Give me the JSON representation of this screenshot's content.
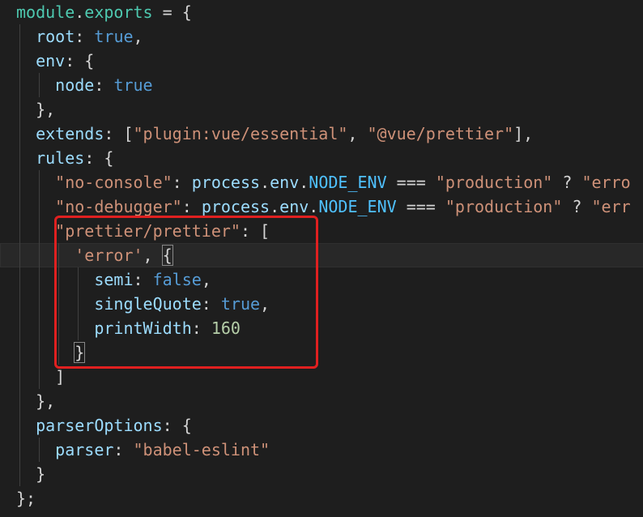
{
  "editor": {
    "theme_background": "#1e1e1e",
    "annotation_color": "#e02020",
    "lines": [
      {
        "tokens": [
          {
            "t": "module",
            "c": "tok-prop"
          },
          {
            "t": ".",
            "c": "tok-punc"
          },
          {
            "t": "exports",
            "c": "tok-prop"
          },
          {
            "t": " = {",
            "c": "tok-punc"
          }
        ]
      },
      {
        "tokens": [
          {
            "t": "  ",
            "c": "tok-punc"
          },
          {
            "t": "root",
            "c": "tok-key"
          },
          {
            "t": ": ",
            "c": "tok-punc"
          },
          {
            "t": "true",
            "c": "tok-kw"
          },
          {
            "t": ",",
            "c": "tok-punc"
          }
        ]
      },
      {
        "tokens": [
          {
            "t": "  ",
            "c": "tok-punc"
          },
          {
            "t": "env",
            "c": "tok-key"
          },
          {
            "t": ": {",
            "c": "tok-punc"
          }
        ]
      },
      {
        "tokens": [
          {
            "t": "    ",
            "c": "tok-punc"
          },
          {
            "t": "node",
            "c": "tok-key"
          },
          {
            "t": ": ",
            "c": "tok-punc"
          },
          {
            "t": "true",
            "c": "tok-kw"
          }
        ]
      },
      {
        "tokens": [
          {
            "t": "  },",
            "c": "tok-punc"
          }
        ]
      },
      {
        "tokens": [
          {
            "t": "  ",
            "c": "tok-punc"
          },
          {
            "t": "extends",
            "c": "tok-key"
          },
          {
            "t": ": [",
            "c": "tok-punc"
          },
          {
            "t": "\"plugin:vue/essential\"",
            "c": "tok-str"
          },
          {
            "t": ", ",
            "c": "tok-punc"
          },
          {
            "t": "\"@vue/prettier\"",
            "c": "tok-str"
          },
          {
            "t": "],",
            "c": "tok-punc"
          }
        ]
      },
      {
        "tokens": [
          {
            "t": "  ",
            "c": "tok-punc"
          },
          {
            "t": "rules",
            "c": "tok-key"
          },
          {
            "t": ": {",
            "c": "tok-punc"
          }
        ]
      },
      {
        "tokens": [
          {
            "t": "    ",
            "c": "tok-punc"
          },
          {
            "t": "\"no-console\"",
            "c": "tok-str"
          },
          {
            "t": ": ",
            "c": "tok-punc"
          },
          {
            "t": "process",
            "c": "tok-ident"
          },
          {
            "t": ".",
            "c": "tok-punc"
          },
          {
            "t": "env",
            "c": "tok-ident"
          },
          {
            "t": ".",
            "c": "tok-punc"
          },
          {
            "t": "NODE_ENV",
            "c": "tok-const"
          },
          {
            "t": " === ",
            "c": "tok-punc"
          },
          {
            "t": "\"production\"",
            "c": "tok-str"
          },
          {
            "t": " ? ",
            "c": "tok-punc"
          },
          {
            "t": "\"erro",
            "c": "tok-str"
          }
        ]
      },
      {
        "tokens": [
          {
            "t": "    ",
            "c": "tok-punc"
          },
          {
            "t": "\"no-debugger\"",
            "c": "tok-str"
          },
          {
            "t": ": ",
            "c": "tok-punc"
          },
          {
            "t": "process",
            "c": "tok-ident"
          },
          {
            "t": ".",
            "c": "tok-punc"
          },
          {
            "t": "env",
            "c": "tok-ident"
          },
          {
            "t": ".",
            "c": "tok-punc"
          },
          {
            "t": "NODE_ENV",
            "c": "tok-const"
          },
          {
            "t": " === ",
            "c": "tok-punc"
          },
          {
            "t": "\"production\"",
            "c": "tok-str"
          },
          {
            "t": " ? ",
            "c": "tok-punc"
          },
          {
            "t": "\"err",
            "c": "tok-str"
          }
        ]
      },
      {
        "tokens": [
          {
            "t": "    ",
            "c": "tok-punc"
          },
          {
            "t": "\"prettier/prettier\"",
            "c": "tok-str"
          },
          {
            "t": ": [",
            "c": "tok-punc"
          }
        ]
      },
      {
        "current": true,
        "tokens": [
          {
            "t": "      ",
            "c": "tok-punc"
          },
          {
            "t": "'error'",
            "c": "tok-str"
          },
          {
            "t": ", ",
            "c": "tok-punc"
          },
          {
            "t": "{",
            "c": "tok-punc bracket-match"
          }
        ]
      },
      {
        "tokens": [
          {
            "t": "        ",
            "c": "tok-punc"
          },
          {
            "t": "semi",
            "c": "tok-key"
          },
          {
            "t": ": ",
            "c": "tok-punc"
          },
          {
            "t": "false",
            "c": "tok-kw"
          },
          {
            "t": ",",
            "c": "tok-punc"
          }
        ]
      },
      {
        "tokens": [
          {
            "t": "        ",
            "c": "tok-punc"
          },
          {
            "t": "singleQuote",
            "c": "tok-key"
          },
          {
            "t": ": ",
            "c": "tok-punc"
          },
          {
            "t": "true",
            "c": "tok-kw"
          },
          {
            "t": ",",
            "c": "tok-punc"
          }
        ]
      },
      {
        "tokens": [
          {
            "t": "        ",
            "c": "tok-punc"
          },
          {
            "t": "printWidth",
            "c": "tok-key"
          },
          {
            "t": ": ",
            "c": "tok-punc"
          },
          {
            "t": "160",
            "c": "tok-num"
          }
        ]
      },
      {
        "tokens": [
          {
            "t": "      ",
            "c": "tok-punc"
          },
          {
            "t": "}",
            "c": "tok-punc bracket-match"
          }
        ]
      },
      {
        "tokens": [
          {
            "t": "    ]",
            "c": "tok-punc"
          }
        ]
      },
      {
        "tokens": [
          {
            "t": "  },",
            "c": "tok-punc"
          }
        ]
      },
      {
        "tokens": [
          {
            "t": "  ",
            "c": "tok-punc"
          },
          {
            "t": "parserOptions",
            "c": "tok-key"
          },
          {
            "t": ": {",
            "c": "tok-punc"
          }
        ]
      },
      {
        "tokens": [
          {
            "t": "    ",
            "c": "tok-punc"
          },
          {
            "t": "parser",
            "c": "tok-key"
          },
          {
            "t": ": ",
            "c": "tok-punc"
          },
          {
            "t": "\"babel-eslint\"",
            "c": "tok-str"
          }
        ]
      },
      {
        "tokens": [
          {
            "t": "  }",
            "c": "tok-punc"
          }
        ]
      },
      {
        "tokens": [
          {
            "t": "};",
            "c": "tok-punc"
          }
        ]
      }
    ]
  }
}
